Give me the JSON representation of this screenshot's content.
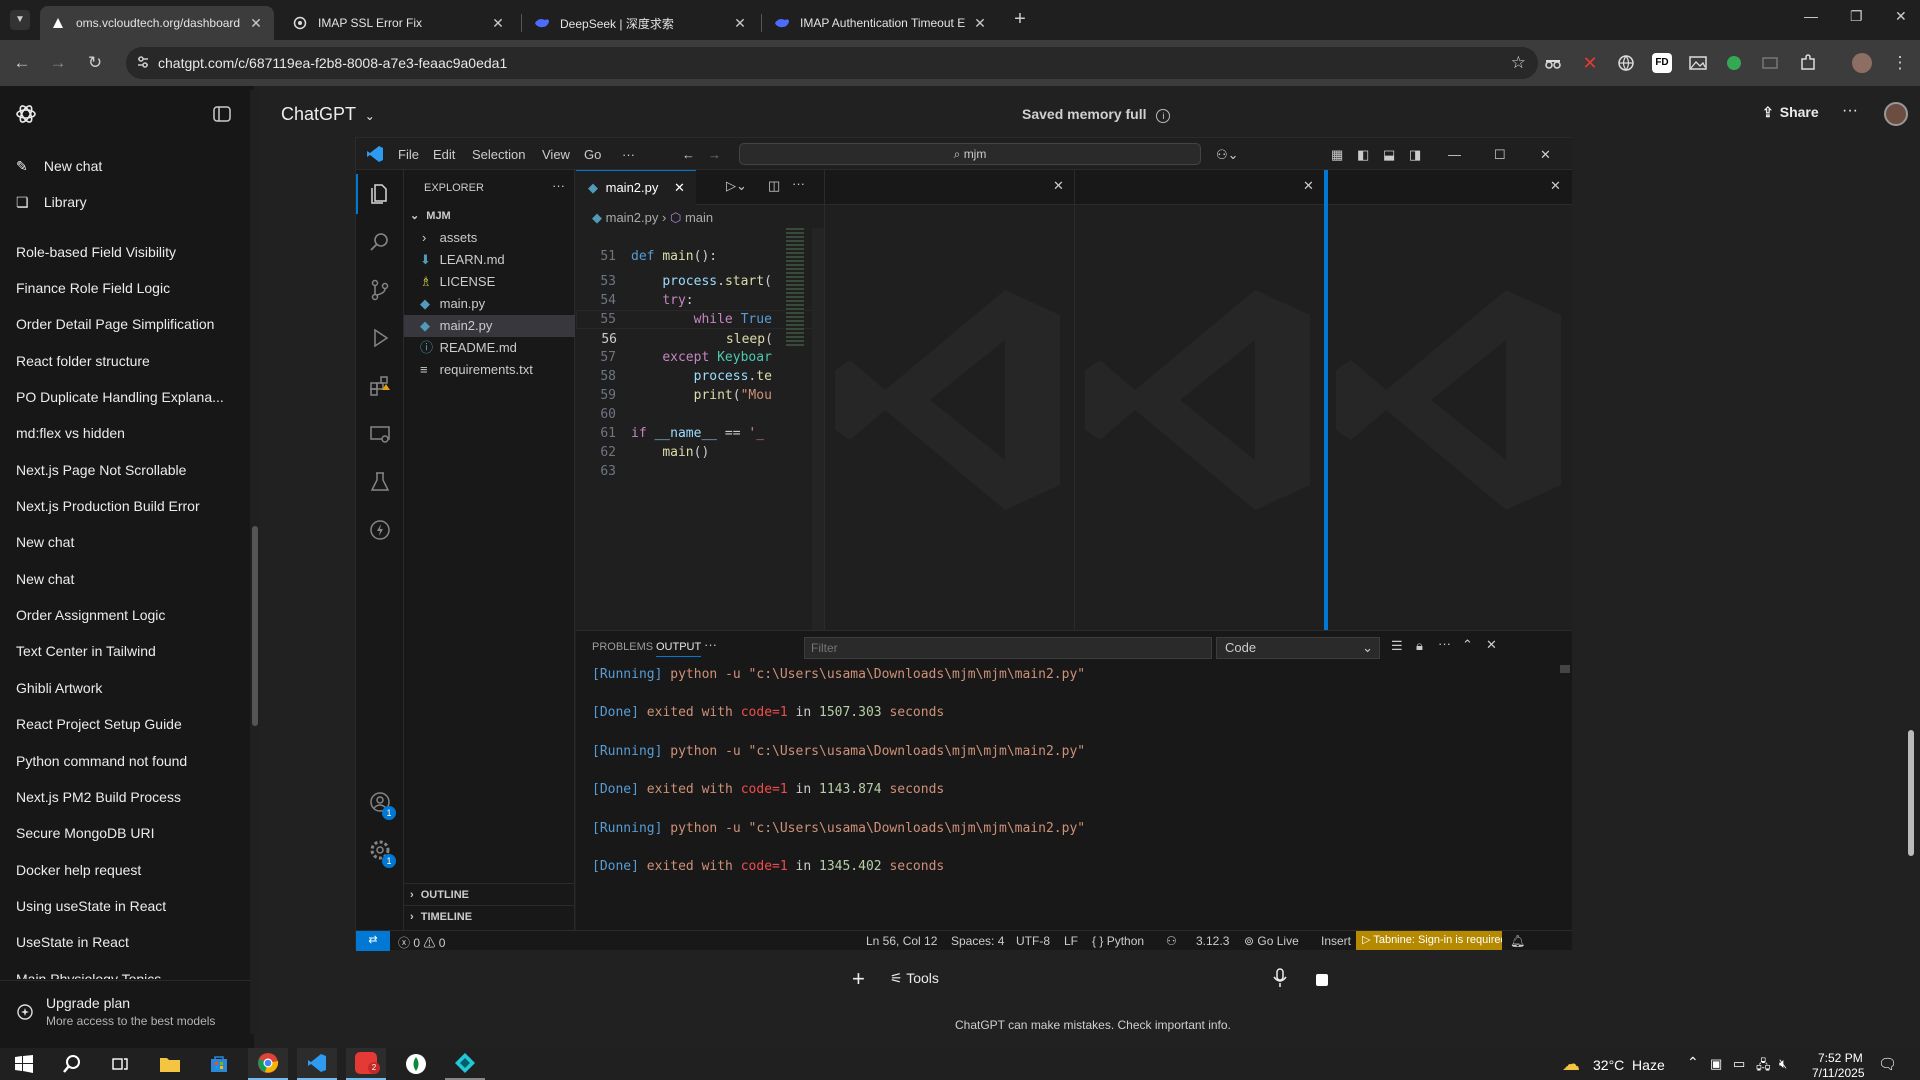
{
  "browser": {
    "tabs": [
      {
        "title": "oms.vcloudtech.org/dashboard",
        "favicon": "vercel-triangle-icon"
      },
      {
        "title": "IMAP SSL Error Fix",
        "favicon": "chatgpt-icon"
      },
      {
        "title": "DeepSeek | 深度求索",
        "favicon": "deepseek-whale-icon"
      },
      {
        "title": "IMAP Authentication Timeout E",
        "favicon": "deepseek-whale-icon"
      }
    ],
    "url": "chatgpt.com/c/687119ea-f2b8-8008-a7e3-feaac9a0eda1",
    "extensions": [
      "incognito-ext",
      "close-red-ext",
      "globe-ext",
      "fd-ext",
      "image-ext",
      "green-ext",
      "cast-ext",
      "puzzle-ext"
    ],
    "fd_label": "FD"
  },
  "sidebar": {
    "new_chat": "New chat",
    "library": "Library",
    "history": [
      "Role-based Field Visibility",
      "Finance Role Field Logic",
      "Order Detail Page Simplification",
      "React folder structure",
      "PO Duplicate Handling Explana...",
      "md:flex vs hidden",
      "Next.js Page Not Scrollable",
      "Next.js Production Build Error",
      "New chat",
      "New chat",
      "Order Assignment Logic",
      "Text Center in Tailwind",
      "Ghibli Artwork",
      "React Project Setup Guide",
      "Python command not found",
      "Next.js PM2 Build Process",
      "Secure MongoDB URI",
      "Docker help request",
      "Using useState in React",
      "UseState in React",
      "Main Physiology Topics"
    ],
    "upgrade_title": "Upgrade plan",
    "upgrade_sub": "More access to the best models"
  },
  "header": {
    "title": "ChatGPT",
    "memory": "Saved memory full",
    "share": "Share"
  },
  "vscode": {
    "menu": [
      "File",
      "Edit",
      "Selection",
      "View",
      "Go",
      "···"
    ],
    "search": "mjm",
    "explorer_title": "EXPLORER",
    "folder": "MJM",
    "files": [
      {
        "name": "assets",
        "icon": "chevron-right-icon"
      },
      {
        "name": "LEARN.md",
        "icon": "markdown-icon"
      },
      {
        "name": "LICENSE",
        "icon": "license-icon"
      },
      {
        "name": "main.py",
        "icon": "python-icon"
      },
      {
        "name": "main2.py",
        "icon": "python-icon"
      },
      {
        "name": "README.md",
        "icon": "info-icon"
      },
      {
        "name": "requirements.txt",
        "icon": "text-icon"
      }
    ],
    "outline": "OUTLINE",
    "timeline": "TIMELINE",
    "editor_tab": "main2.py",
    "breadcrumb_file": "main2.py",
    "breadcrumb_symbol": "main",
    "code": [
      {
        "ln": "51",
        "text": "def main():"
      },
      {
        "ln": "53",
        "text": "    process.start("
      },
      {
        "ln": "54",
        "text": "    try:"
      },
      {
        "ln": "55",
        "text": "        while True"
      },
      {
        "ln": "56",
        "text": "            sleep("
      },
      {
        "ln": "57",
        "text": "    except Keyboar"
      },
      {
        "ln": "58",
        "text": "        process.te"
      },
      {
        "ln": "59",
        "text": "        print(\"Mou"
      },
      {
        "ln": "60",
        "text": ""
      },
      {
        "ln": "61",
        "text": "if __name__ == '_"
      },
      {
        "ln": "62",
        "text": "    main()"
      },
      {
        "ln": "63",
        "text": ""
      }
    ],
    "panel_tabs": [
      "PROBLEMS",
      "OUTPUT"
    ],
    "filter_placeholder": "Filter",
    "output_channel": "Code",
    "output": [
      {
        "tag": "[Running]",
        "text": " python -u \"c:\\Users\\usama\\Downloads\\mjm\\mjm\\main2.py\""
      },
      {
        "tag": "[Done]",
        "text": " exited with ",
        "code": "code=1",
        "in": " in ",
        "secs": "1507.303",
        "tail": " seconds"
      },
      {
        "tag": "[Running]",
        "text": " python -u \"c:\\Users\\usama\\Downloads\\mjm\\mjm\\main2.py\""
      },
      {
        "tag": "[Done]",
        "text": " exited with ",
        "code": "code=1",
        "in": " in ",
        "secs": "1143.874",
        "tail": " seconds"
      },
      {
        "tag": "[Running]",
        "text": " python -u \"c:\\Users\\usama\\Downloads\\mjm\\mjm\\main2.py\""
      },
      {
        "tag": "[Done]",
        "text": " exited with ",
        "code": "code=1",
        "in": " in ",
        "secs": "1345.402",
        "tail": " seconds"
      }
    ],
    "status": {
      "errors": "0",
      "warnings": "0",
      "position": "Ln 56, Col 12",
      "spaces": "Spaces: 4",
      "encoding": "UTF-8",
      "eol": "LF",
      "language": "Python",
      "version": "3.12.3",
      "golive": "Go Live",
      "mode": "Insert",
      "tabnine": "Tabnine: Sign-in is required"
    },
    "badge_accounts": "1",
    "badge_settings": "1"
  },
  "composer": {
    "tools": "Tools",
    "disclaimer": "ChatGPT can make mistakes. Check important info."
  },
  "taskbar": {
    "weather": "32°C  Haze",
    "time": "7:52 PM",
    "date": "7/11/2025",
    "zoom_badge": "2"
  }
}
